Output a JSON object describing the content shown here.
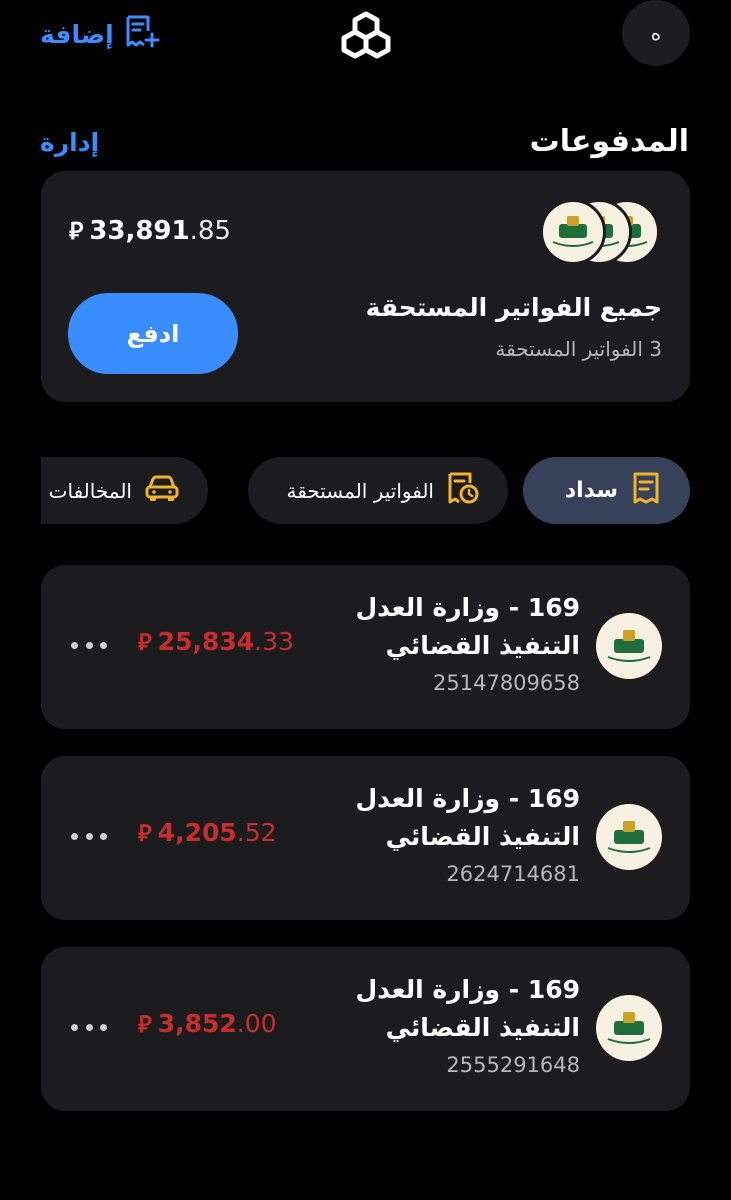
{
  "header": {
    "add_label": "إضافة",
    "avatar_initial": "ه",
    "add_icon": "receipt-plus-icon",
    "logo_icon": "bank-logo-icon"
  },
  "payments": {
    "title": "المدفوعات",
    "manage_label": "إدارة"
  },
  "summary": {
    "total_integer": "33,891",
    "total_decimal": ".85",
    "currency_symbol": "⃁",
    "pay_label": "ادفع",
    "title": "جميع الفواتير المستحقة",
    "subtitle": "3 الفواتير المستحقة"
  },
  "tabs": [
    {
      "label": "سداد",
      "icon": "receipt-icon",
      "active": true
    },
    {
      "label": "الفواتير المستحقة",
      "icon": "bill-clock-icon",
      "active": false
    },
    {
      "label": "المخالفات",
      "icon": "car-icon",
      "active": false
    }
  ],
  "bills": [
    {
      "title": "169 - وزارة العدل",
      "subtitle": "التنفيذ القضائي",
      "number": "25147809658",
      "amount_integer": "25,834",
      "amount_decimal": ".33"
    },
    {
      "title": "169 - وزارة العدل",
      "subtitle": "التنفيذ القضائي",
      "number": "2624714681",
      "amount_integer": "4,205",
      "amount_decimal": ".52"
    },
    {
      "title": "169 - وزارة العدل",
      "subtitle": "التنفيذ القضائي",
      "number": "2555291648",
      "amount_integer": "3,852",
      "amount_decimal": ".00"
    }
  ],
  "colors": {
    "background": "#000000",
    "card": "#1c1c1e",
    "accent_blue": "#3a8dff",
    "active_tab": "#38415a",
    "amount_red": "#c62e2e",
    "icon_gold": "#f0b429"
  }
}
